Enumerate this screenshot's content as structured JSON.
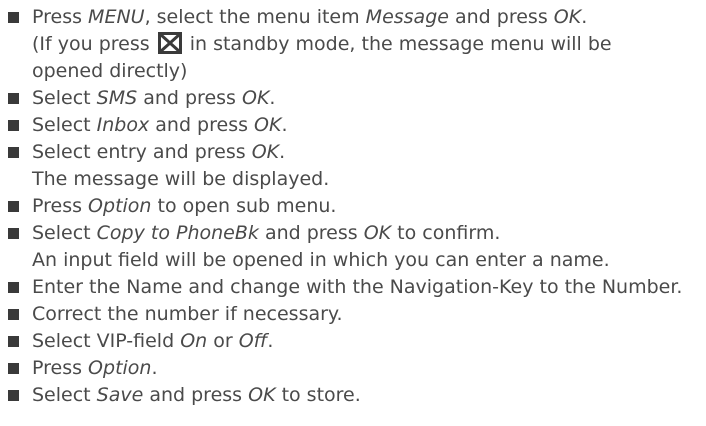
{
  "steps": [
    {
      "parts": [
        {
          "t": "Press ",
          "i": false
        },
        {
          "t": "MENU",
          "i": true
        },
        {
          "t": ", select the menu item ",
          "i": false
        },
        {
          "t": "Message",
          "i": true
        },
        {
          "t": " and press ",
          "i": false
        },
        {
          "t": "OK",
          "i": true
        },
        {
          "t": ".",
          "i": false
        }
      ],
      "notes": [
        {
          "parts": [
            {
              "t": "(If you press ",
              "i": false
            },
            {
              "icon": "envelope-icon"
            },
            {
              "t": " in standby mode, the message menu will be",
              "i": false
            }
          ]
        },
        {
          "parts": [
            {
              "t": "opened directly)",
              "i": false
            }
          ]
        }
      ]
    },
    {
      "parts": [
        {
          "t": "Select ",
          "i": false
        },
        {
          "t": "SMS",
          "i": true
        },
        {
          "t": " and press ",
          "i": false
        },
        {
          "t": "OK",
          "i": true
        },
        {
          "t": ".",
          "i": false
        }
      ],
      "notes": []
    },
    {
      "parts": [
        {
          "t": "Select ",
          "i": false
        },
        {
          "t": "Inbox",
          "i": true
        },
        {
          "t": " and press ",
          "i": false
        },
        {
          "t": "OK",
          "i": true
        },
        {
          "t": ".",
          "i": false
        }
      ],
      "notes": []
    },
    {
      "parts": [
        {
          "t": "Select entry and press ",
          "i": false
        },
        {
          "t": "OK",
          "i": true
        },
        {
          "t": ".",
          "i": false
        }
      ],
      "notes": [
        {
          "parts": [
            {
              "t": "The message will be displayed.",
              "i": false
            }
          ]
        }
      ]
    },
    {
      "parts": [
        {
          "t": "Press ",
          "i": false
        },
        {
          "t": "Option",
          "i": true
        },
        {
          "t": " to open sub menu.",
          "i": false
        }
      ],
      "notes": []
    },
    {
      "parts": [
        {
          "t": "Select ",
          "i": false
        },
        {
          "t": "Copy to PhoneBk",
          "i": true
        },
        {
          "t": " and press ",
          "i": false
        },
        {
          "t": "OK",
          "i": true
        },
        {
          "t": " to confirm.",
          "i": false
        }
      ],
      "notes": [
        {
          "parts": [
            {
              "t": "An input field will be opened in which you can enter a name.",
              "i": false
            }
          ]
        }
      ]
    },
    {
      "parts": [
        {
          "t": "Enter the Name and change with the Navigation-Key to the Number.",
          "i": false
        }
      ],
      "notes": []
    },
    {
      "parts": [
        {
          "t": "Correct the number if necessary.",
          "i": false
        }
      ],
      "notes": []
    },
    {
      "parts": [
        {
          "t": "Select VIP-field ",
          "i": false
        },
        {
          "t": "On",
          "i": true
        },
        {
          "t": " or ",
          "i": false
        },
        {
          "t": "Off",
          "i": true
        },
        {
          "t": ".",
          "i": false
        }
      ],
      "notes": []
    },
    {
      "parts": [
        {
          "t": "Press ",
          "i": false
        },
        {
          "t": "Option",
          "i": true
        },
        {
          "t": ".",
          "i": false
        }
      ],
      "notes": []
    },
    {
      "parts": [
        {
          "t": "Select ",
          "i": false
        },
        {
          "t": "Save",
          "i": true
        },
        {
          "t": " and press ",
          "i": false
        },
        {
          "t": "OK",
          "i": true
        },
        {
          "t": " to store.",
          "i": false
        }
      ],
      "notes": []
    }
  ]
}
